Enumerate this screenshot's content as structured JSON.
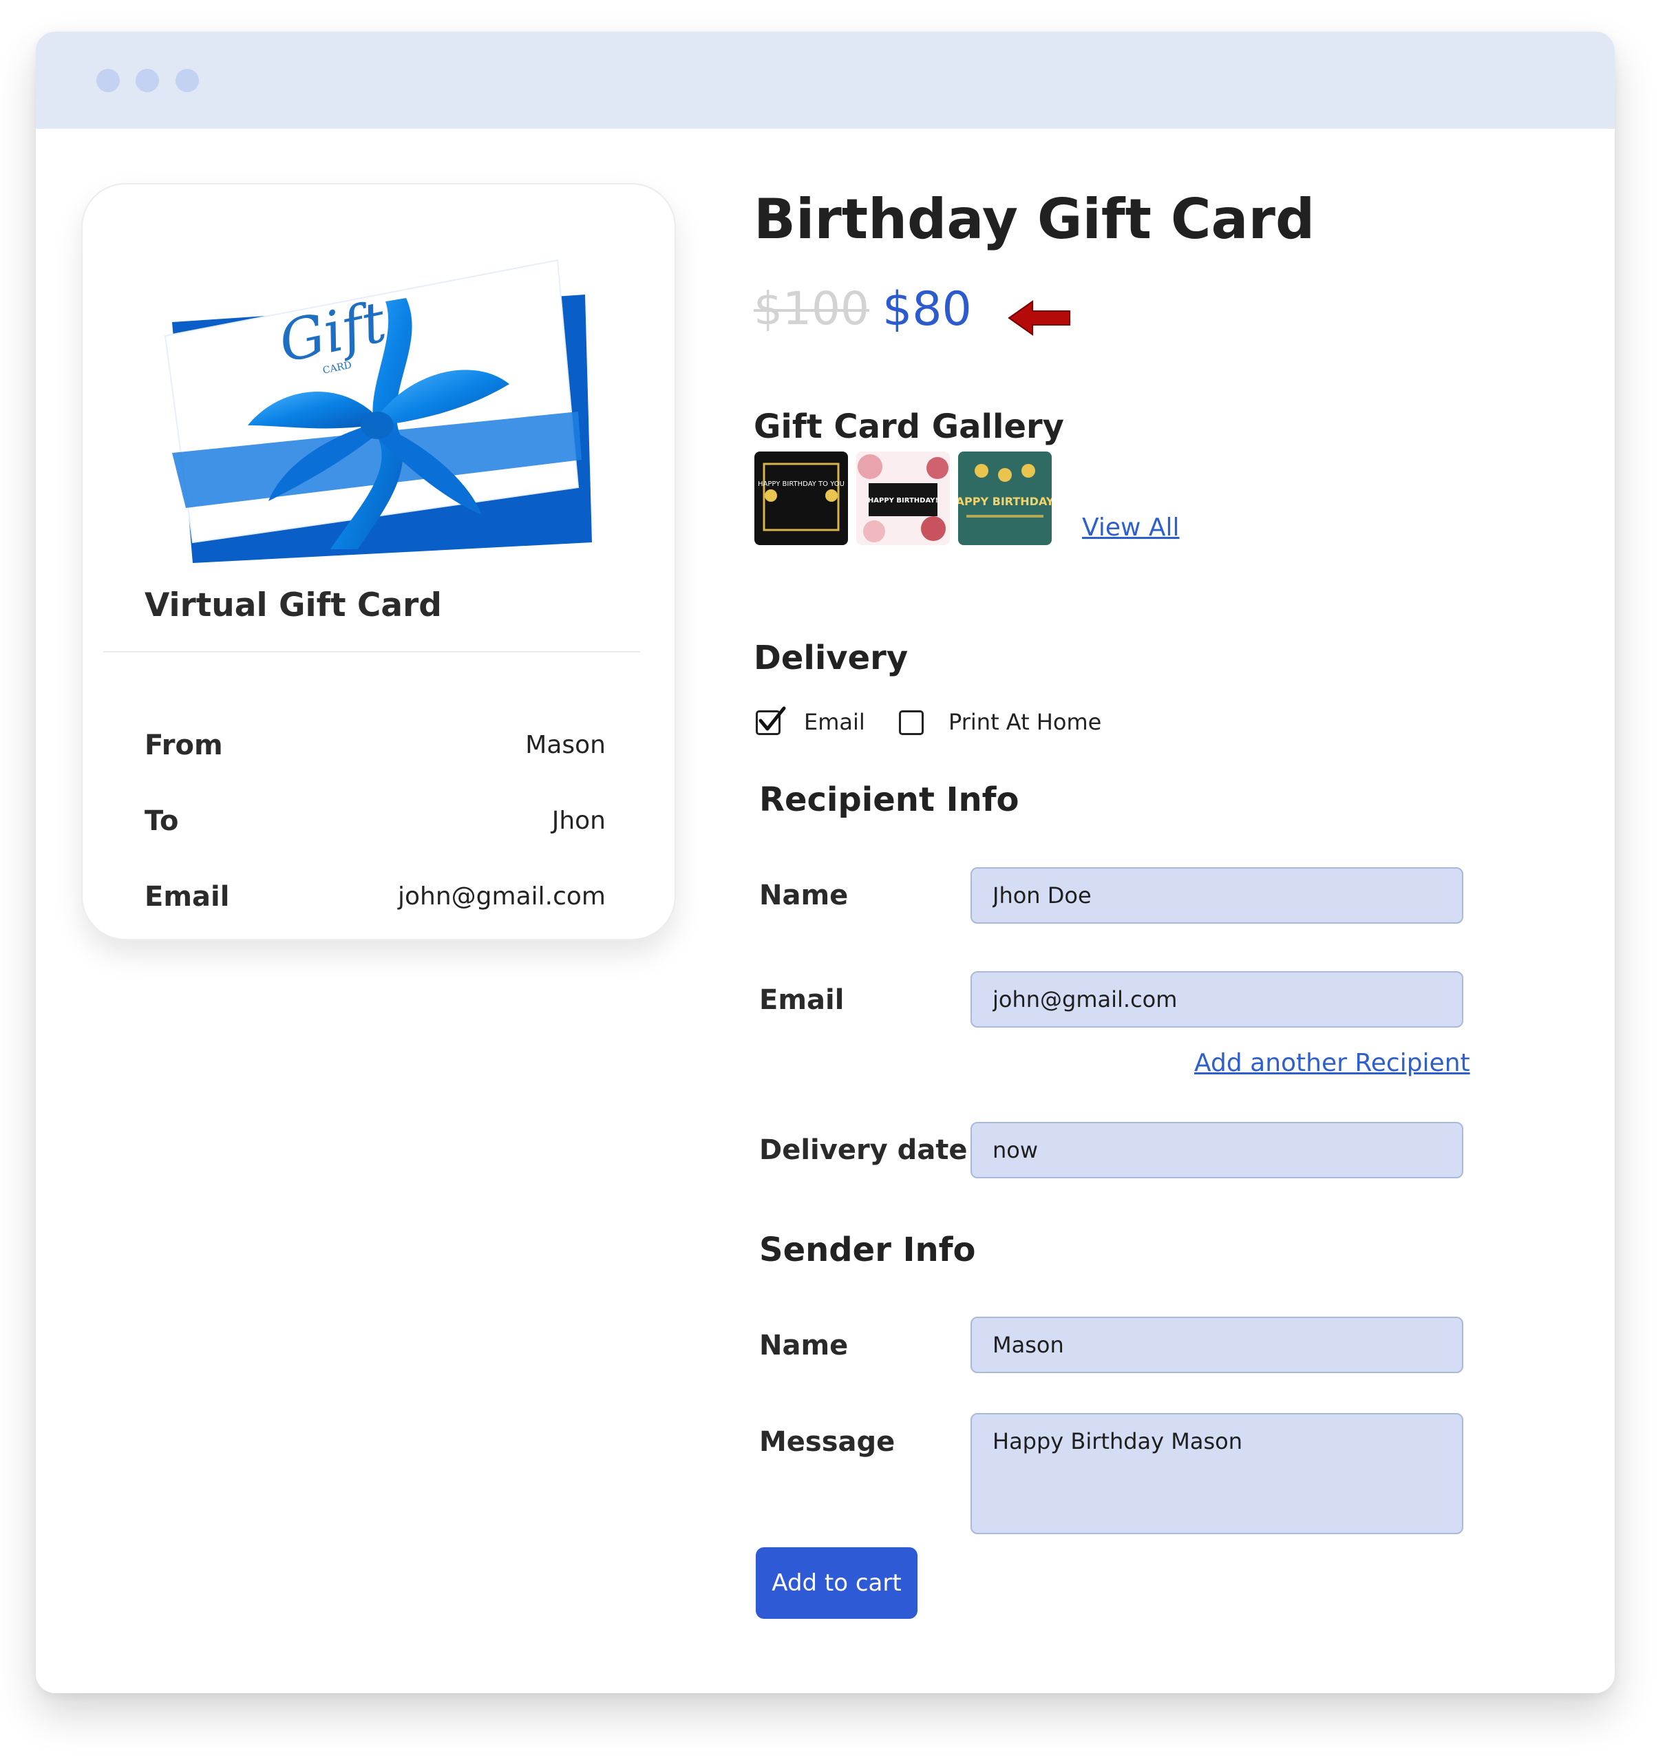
{
  "browser": {
    "dots": [
      "dot-1",
      "dot-2",
      "dot-3"
    ]
  },
  "preview_card": {
    "image_text": "Gift",
    "image_subtext": "CARD",
    "title": "Virtual Gift Card",
    "rows": [
      {
        "label": "From",
        "value": "Mason"
      },
      {
        "label": "To",
        "value": "Jhon"
      },
      {
        "label": "Email",
        "value": "john@gmail.com"
      }
    ]
  },
  "product": {
    "title": "Birthday Gift Card",
    "price_old": "$100",
    "price_new": "$80"
  },
  "gallery": {
    "title": "Gift Card Gallery",
    "thumbnails": [
      {
        "text": "HAPPY BIRTHDAY TO YOU"
      },
      {
        "text": "HAPPY BIRTHDAY!"
      },
      {
        "text": "APPY BIRTHDAY"
      }
    ],
    "view_all": "View All"
  },
  "delivery": {
    "title": "Delivery",
    "options": [
      {
        "label": "Email",
        "checked": true
      },
      {
        "label": "Print At Home",
        "checked": false
      }
    ]
  },
  "recipient": {
    "title": "Recipient Info",
    "name_label": "Name",
    "name_value": "Jhon Doe",
    "email_label": "Email",
    "email_value": "john@gmail.com",
    "add_another": "Add another Recipient",
    "date_label": "Delivery date:",
    "date_value": "now"
  },
  "sender": {
    "title": "Sender Info",
    "name_label": "Name",
    "name_value": "Mason",
    "message_label": "Message",
    "message_value": "Happy Birthday Mason"
  },
  "actions": {
    "add_to_cart": "Add to cart"
  },
  "colors": {
    "accent": "#2e5bd5",
    "price": "#2c5bd0",
    "arrow": "#b50a0a",
    "field_bg": "#d5ddf4",
    "titlebar": "#e0e8f5"
  }
}
